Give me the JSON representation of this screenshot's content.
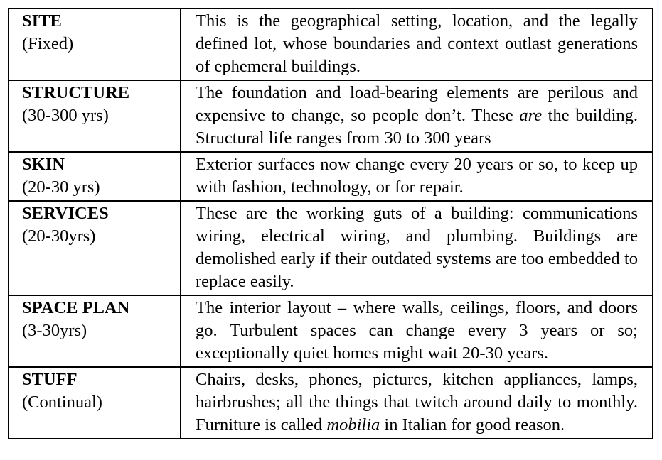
{
  "rows": [
    {
      "name": "SITE",
      "span": "(Fixed)",
      "desc": [
        "This is the geographical setting, location, and the legally defined lot, whose boundaries and context outlast generations of ephemeral buildings."
      ]
    },
    {
      "name": "STRUCTURE",
      "span": "(30-300 yrs)",
      "desc": [
        "The foundation and load-bearing elements are perilous and expensive to change, so people don’t. These ",
        "are",
        " the building. Structural life ranges from 30 to 300 years"
      ]
    },
    {
      "name": "SKIN",
      "span": "(20-30 yrs)",
      "desc": [
        "Exterior surfaces now change every 20 years or so, to keep up with fashion, technology, or for repair."
      ]
    },
    {
      "name": "SERVICES",
      "span": "(20-30yrs)",
      "desc": [
        "These are the working guts of a building: communications wiring, electrical wiring, and plumbing. Buildings are demolished early if their outdated systems are too embedded to replace easily."
      ]
    },
    {
      "name": "SPACE PLAN",
      "span": "(3-30yrs)",
      "desc": [
        "The interior layout – where walls, ceilings, floors, and doors go. Turbulent spaces can change every 3 years or so; exceptionally quiet homes might wait 20-30 years."
      ]
    },
    {
      "name": "STUFF",
      "span": "(Continual)",
      "desc": [
        "Chairs, desks, phones, pictures, kitchen appliances, lamps, hairbrushes; all the things that twitch around daily to monthly. Furniture is called ",
        "mobilia",
        " in Italian for good reason."
      ]
    }
  ]
}
